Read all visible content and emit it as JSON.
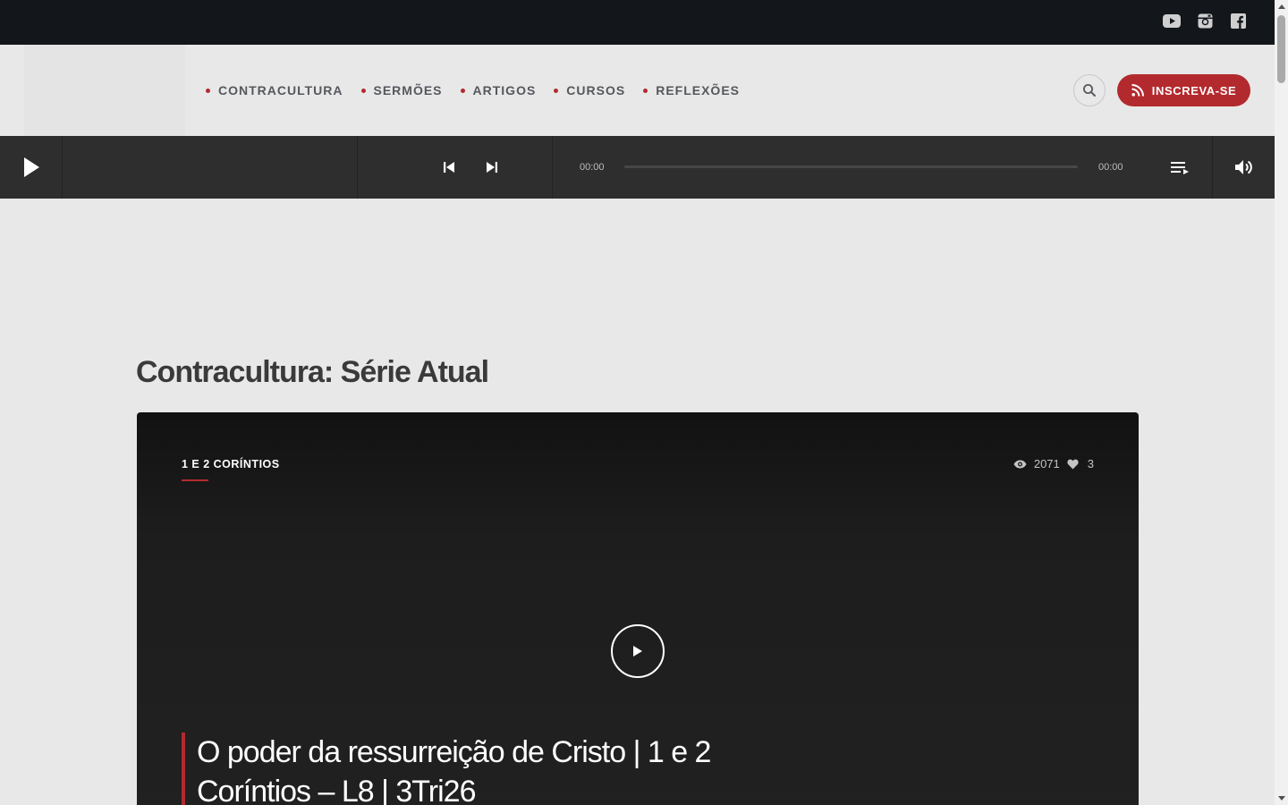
{
  "topbar": {
    "social": [
      {
        "name": "youtube-icon"
      },
      {
        "name": "instagram-icon"
      },
      {
        "name": "facebook-icon"
      }
    ]
  },
  "nav": {
    "items": [
      {
        "label": "CONTRACULTURA"
      },
      {
        "label": "SERMÕES"
      },
      {
        "label": "ARTIGOS"
      },
      {
        "label": "CURSOS"
      },
      {
        "label": "REFLEXÕES"
      }
    ]
  },
  "header": {
    "subscribe_label": "INSCREVA-SE"
  },
  "player": {
    "current_time": "00:00",
    "duration": "00:00",
    "progress": 0
  },
  "section": {
    "title": "Contracultura: Série Atual"
  },
  "featured": {
    "category": "1 E 2 CORÍNTIOS",
    "views": "2071",
    "likes": "3",
    "title": "O poder da ressurreição de Cristo | 1 e 2 Coríntios – L8 | 3Tri26"
  },
  "colors": {
    "accent": "#b32a2e",
    "topbar": "#13171b",
    "player": "#2e2e2e",
    "background": "#e8e8e8"
  }
}
